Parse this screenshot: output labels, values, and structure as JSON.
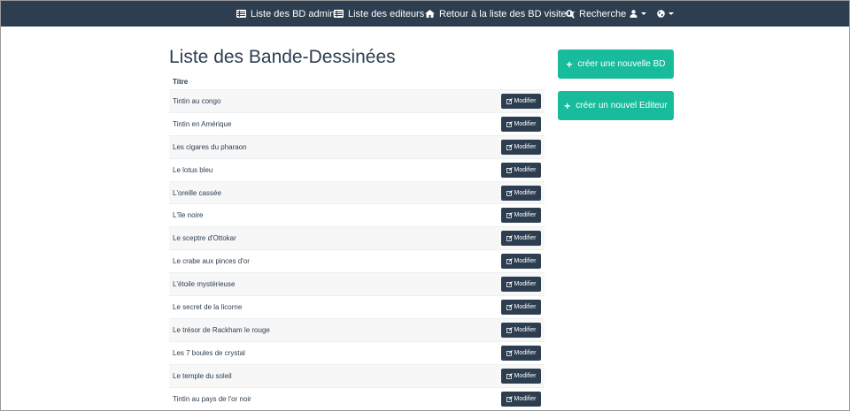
{
  "navbar": {
    "items": [
      {
        "label": "Liste des BD admin",
        "icon": "list-icon"
      },
      {
        "label": "Liste des editeurs",
        "icon": "list-icon"
      },
      {
        "label": "Retour à la liste des BD visiteur",
        "icon": "home-icon"
      },
      {
        "label": "Recherche",
        "icon": "search-icon"
      }
    ],
    "user_menu_icon": "user-icon",
    "language_menu_icon": "globe-icon"
  },
  "main": {
    "title": "Liste des Bande-Dessinées",
    "column_header": "Titre",
    "modify_label": "Modifier",
    "rows": [
      {
        "title": "Tintin au congo"
      },
      {
        "title": "Tintin en Amérique"
      },
      {
        "title": "Les cigares du pharaon"
      },
      {
        "title": "Le lotus bleu"
      },
      {
        "title": "L'oreille cassée"
      },
      {
        "title": "L'île noire"
      },
      {
        "title": "Le sceptre d'Ottokar"
      },
      {
        "title": "Le crabe aux pinces d'or"
      },
      {
        "title": "L'étoile mystérieuse"
      },
      {
        "title": "Le secret de la licorne"
      },
      {
        "title": "Le trésor de Rackham le rouge"
      },
      {
        "title": "Les 7 boules de crystal"
      },
      {
        "title": "Le temple du soleil"
      },
      {
        "title": "Tintin au pays de l'or noir"
      }
    ]
  },
  "sidebar": {
    "create_bd_label": "créer une nouvelle BD",
    "create_editor_label": "créer un nouvel Editeur"
  },
  "colors": {
    "navbar": "#2c3e50",
    "primary_button": "#2c3e50",
    "success_button": "#18bc9c",
    "striped_row": "#f7f7f7"
  }
}
